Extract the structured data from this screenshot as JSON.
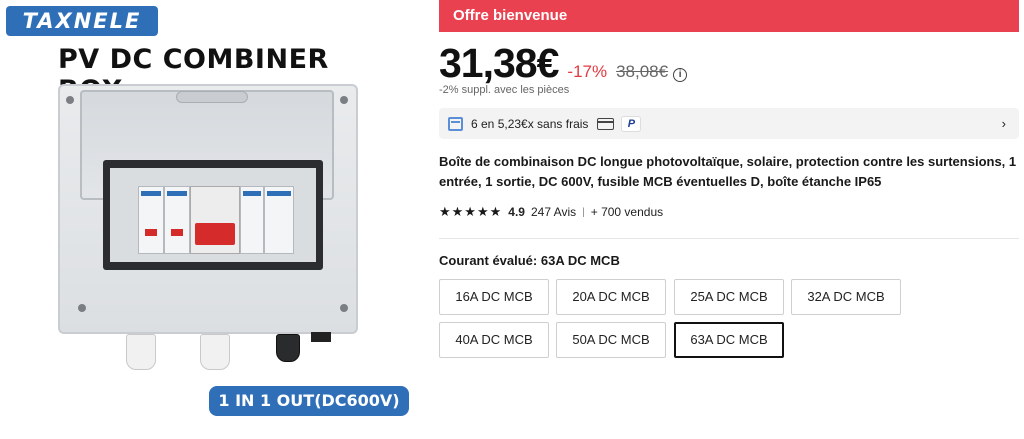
{
  "image": {
    "brand": "TAXNELE",
    "headline": "PV DC COMBINER BOX",
    "caption": "1 IN 1 OUT(DC600V)"
  },
  "banner": {
    "label": "Offre bienvenue",
    "color": "#e94150"
  },
  "price": {
    "current": "31,38€",
    "discount": "-17%",
    "original": "38,08€",
    "extra": "-2% suppl. avec les pièces"
  },
  "installments": {
    "text": "6 en 5,23€x sans frais",
    "paypal": "P"
  },
  "product": {
    "title": "Boîte de combinaison DC longue photovoltaïque, solaire, protection contre les surtensions, 1 entrée, 1 sortie, DC 600V, fusible MCB éventuelles D, boîte étanche IP65",
    "rating": "4.9",
    "reviews": "247 Avis",
    "sold": "+ 700 vendus",
    "stars": "★★★★★"
  },
  "variant": {
    "label": "Courant évalué: 63A DC MCB",
    "options": [
      "16A DC MCB",
      "20A DC MCB",
      "25A DC MCB",
      "32A DC MCB",
      "40A DC MCB",
      "50A DC MCB",
      "63A DC MCB"
    ],
    "selected": "63A DC MCB"
  }
}
